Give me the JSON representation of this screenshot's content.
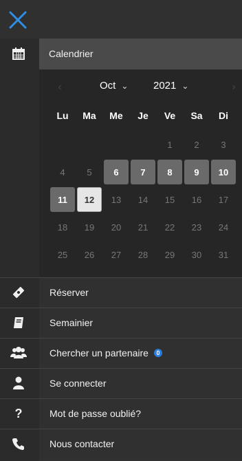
{
  "header": {
    "close_icon": "close-icon",
    "accent": "#2f8fe6"
  },
  "calendar": {
    "title": "Calendrier",
    "month": "Oct",
    "year": "2021",
    "weekdays": [
      "Lu",
      "Ma",
      "Me",
      "Je",
      "Ve",
      "Sa",
      "Di"
    ],
    "weeks": [
      [
        {
          "day": "",
          "state": "empty"
        },
        {
          "day": "",
          "state": "empty"
        },
        {
          "day": "",
          "state": "empty"
        },
        {
          "day": "",
          "state": "empty"
        },
        {
          "day": "1",
          "state": "disabled"
        },
        {
          "day": "2",
          "state": "disabled"
        },
        {
          "day": "3",
          "state": "disabled"
        }
      ],
      [
        {
          "day": "4",
          "state": "disabled"
        },
        {
          "day": "5",
          "state": "disabled"
        },
        {
          "day": "6",
          "state": "active"
        },
        {
          "day": "7",
          "state": "active"
        },
        {
          "day": "8",
          "state": "active"
        },
        {
          "day": "9",
          "state": "active"
        },
        {
          "day": "10",
          "state": "active"
        }
      ],
      [
        {
          "day": "11",
          "state": "active"
        },
        {
          "day": "12",
          "state": "today"
        },
        {
          "day": "13",
          "state": "disabled"
        },
        {
          "day": "14",
          "state": "disabled"
        },
        {
          "day": "15",
          "state": "disabled"
        },
        {
          "day": "16",
          "state": "disabled"
        },
        {
          "day": "17",
          "state": "disabled"
        }
      ],
      [
        {
          "day": "18",
          "state": "disabled"
        },
        {
          "day": "19",
          "state": "disabled"
        },
        {
          "day": "20",
          "state": "disabled"
        },
        {
          "day": "21",
          "state": "disabled"
        },
        {
          "day": "22",
          "state": "disabled"
        },
        {
          "day": "23",
          "state": "disabled"
        },
        {
          "day": "24",
          "state": "disabled"
        }
      ],
      [
        {
          "day": "25",
          "state": "disabled"
        },
        {
          "day": "26",
          "state": "disabled"
        },
        {
          "day": "27",
          "state": "disabled"
        },
        {
          "day": "28",
          "state": "disabled"
        },
        {
          "day": "29",
          "state": "disabled"
        },
        {
          "day": "30",
          "state": "disabled"
        },
        {
          "day": "31",
          "state": "disabled"
        }
      ]
    ]
  },
  "menu": {
    "items": [
      {
        "label": "Réserver",
        "icon": "ticket-icon"
      },
      {
        "label": "Semainier",
        "icon": "book-icon"
      },
      {
        "label": "Chercher un partenaire",
        "icon": "users-icon",
        "badge": "0"
      },
      {
        "label": "Se connecter",
        "icon": "user-icon"
      },
      {
        "label": "Mot de passe oublié?",
        "icon": "question-icon"
      },
      {
        "label": "Nous contacter",
        "icon": "phone-icon"
      }
    ]
  }
}
